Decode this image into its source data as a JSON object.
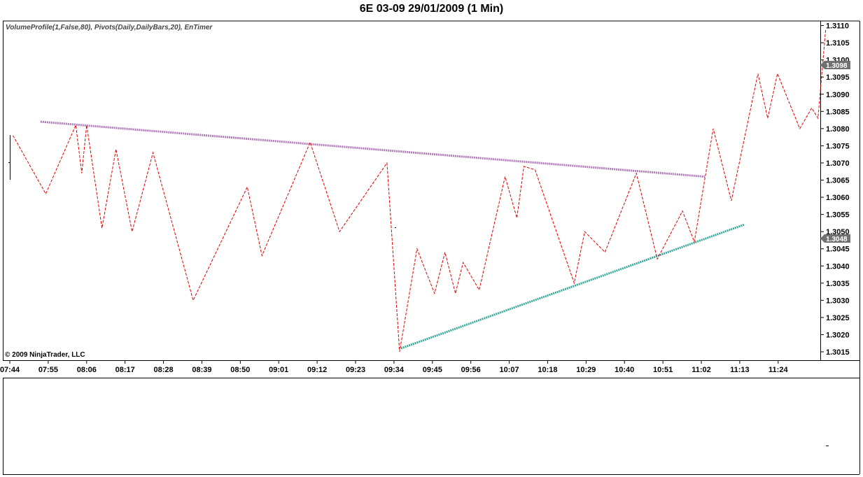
{
  "title": "6E 03-09  29/01/2009 (1 Min)",
  "indicator_label": "VolumeProfile(1,False,80), Pivots(Daily,DailyBars,20), EnTimer",
  "copyright": "© 2009 NinjaTrader, LLC",
  "colors": {
    "price": "#e00000",
    "upper_trendline": "#b07ab8",
    "lower_trendline": "#3aa89a",
    "marker_bg": "#707070",
    "axis": "#000000"
  },
  "price_markers": [
    "1.3098",
    "1.3048"
  ],
  "chart_data": {
    "type": "line",
    "title": "6E 03-09  29/01/2009 (1 Min)",
    "xlabel": "",
    "ylabel": "",
    "x_ticks": [
      "07:44",
      "07:55",
      "08:06",
      "08:17",
      "08:28",
      "08:39",
      "08:50",
      "09:01",
      "09:12",
      "09:23",
      "09:34",
      "09:45",
      "09:56",
      "10:07",
      "10:18",
      "10:29",
      "10:40",
      "10:51",
      "11:02",
      "11:13",
      "11:24"
    ],
    "y_ticks": [
      "1.3015",
      "1.3020",
      "1.3025",
      "1.3030",
      "1.3035",
      "1.3040",
      "1.3045",
      "1.3050",
      "1.3055",
      "1.3060",
      "1.3065",
      "1.3070",
      "1.3075",
      "1.3080",
      "1.3085",
      "1.3090",
      "1.3095",
      "1.3100",
      "1.3105",
      "1.3110"
    ],
    "ylim": [
      1.3013,
      1.3112
    ],
    "xlim_minutes": [
      0,
      231
    ],
    "grid": false,
    "series": [
      {
        "values": [
          [
            0.9,
            1.3078
          ],
          [
            10.3,
            1.3061
          ],
          [
            18.9,
            1.3081
          ],
          [
            20.6,
            1.3067
          ],
          [
            22.0,
            1.3081
          ],
          [
            26.4,
            1.3051
          ],
          [
            30.4,
            1.3074
          ],
          [
            35.0,
            1.305
          ],
          [
            41.0,
            1.3073
          ],
          [
            52.5,
            1.303
          ],
          [
            68.0,
            1.3063
          ],
          [
            72.2,
            1.3043
          ],
          [
            86.0,
            1.3076
          ],
          [
            94.4,
            1.305
          ],
          [
            108.0,
            1.307
          ],
          [
            111.6,
            1.3015
          ],
          [
            116.6,
            1.3045
          ],
          [
            121.6,
            1.3032
          ],
          [
            124.6,
            1.3044
          ],
          [
            127.6,
            1.3032
          ],
          [
            129.8,
            1.3041
          ],
          [
            134.4,
            1.3033
          ],
          [
            141.8,
            1.3066
          ],
          [
            145.2,
            1.3054
          ],
          [
            147.2,
            1.3069
          ],
          [
            150.4,
            1.3068
          ],
          [
            161.6,
            1.3035
          ],
          [
            164.6,
            1.305
          ],
          [
            170.4,
            1.3044
          ],
          [
            179.4,
            1.3067
          ],
          [
            185.4,
            1.3042
          ],
          [
            192.6,
            1.3056
          ],
          [
            196.0,
            1.3047
          ],
          [
            201.4,
            1.308
          ],
          [
            206.6,
            1.3059
          ],
          [
            214.2,
            1.3096
          ],
          [
            217.0,
            1.3083
          ],
          [
            219.8,
            1.3096
          ],
          [
            226.2,
            1.308
          ],
          [
            229.6,
            1.3086
          ],
          [
            231.4,
            1.3083
          ],
          [
            233.6,
            1.3109
          ]
        ]
      }
    ],
    "trendlines": [
      {
        "start": [
          8.8,
          1.3082
        ],
        "end": [
          199.0,
          1.3066
        ]
      },
      {
        "start": [
          112.0,
          1.3016
        ],
        "end": [
          210.2,
          1.3052
        ]
      }
    ]
  }
}
